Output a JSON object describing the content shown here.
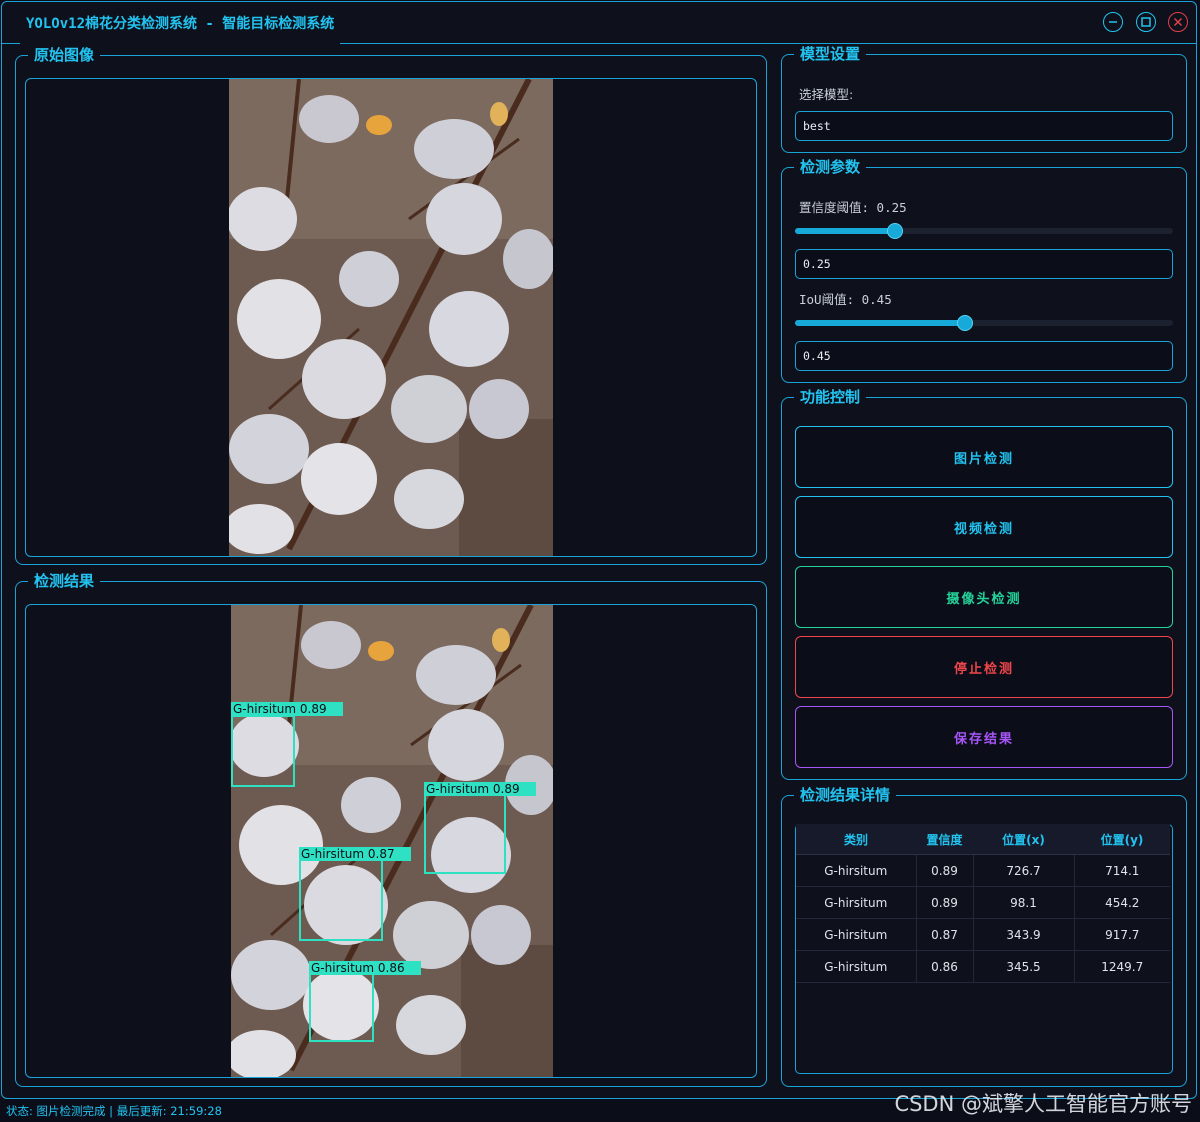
{
  "window": {
    "title": "YOLOv12棉花分类检测系统 - 智能目标检测系统"
  },
  "panels": {
    "original": {
      "title": "原始图像"
    },
    "result": {
      "title": "检测结果"
    },
    "model": {
      "title": "模型设置",
      "select_label": "选择模型:",
      "select_value": "best"
    },
    "params": {
      "title": "检测参数",
      "conf_label": "置信度阈值: 0.25",
      "conf_value": "0.25",
      "conf_level": 0.25,
      "iou_label": "IoU阈值: 0.45",
      "iou_value": "0.45",
      "iou_level": 0.45
    },
    "controls": {
      "title": "功能控制",
      "buttons": [
        {
          "label": "图片检测",
          "color": "#22c3f0"
        },
        {
          "label": "视频检测",
          "color": "#22c3f0"
        },
        {
          "label": "摄像头检测",
          "color": "#25d39a"
        },
        {
          "label": "停止检测",
          "color": "#f0454a"
        },
        {
          "label": "保存结果",
          "color": "#a855f7"
        }
      ]
    },
    "details": {
      "title": "检测结果详情",
      "columns": [
        "类别",
        "置信度",
        "位置(x)",
        "位置(y)"
      ],
      "rows": [
        [
          "G-hirsitum",
          "0.89",
          "726.7",
          "714.1"
        ],
        [
          "G-hirsitum",
          "0.89",
          "98.1",
          "454.2"
        ],
        [
          "G-hirsitum",
          "0.87",
          "343.9",
          "917.7"
        ],
        [
          "G-hirsitum",
          "0.86",
          "345.5",
          "1249.7"
        ]
      ]
    }
  },
  "detections": [
    {
      "label": "G-hirsitum 0.89"
    },
    {
      "label": "G-hirsitum 0.89"
    },
    {
      "label": "G-hirsitum 0.87"
    },
    {
      "label": "G-hirsitum 0.86"
    }
  ],
  "status": {
    "text": "状态: 图片检测完成 | 最后更新: 21:59:28"
  },
  "watermark": "CSDN @斌擎人工智能官方账号",
  "colors": {
    "accent": "#22c3f0",
    "box": "#2de1c2"
  }
}
